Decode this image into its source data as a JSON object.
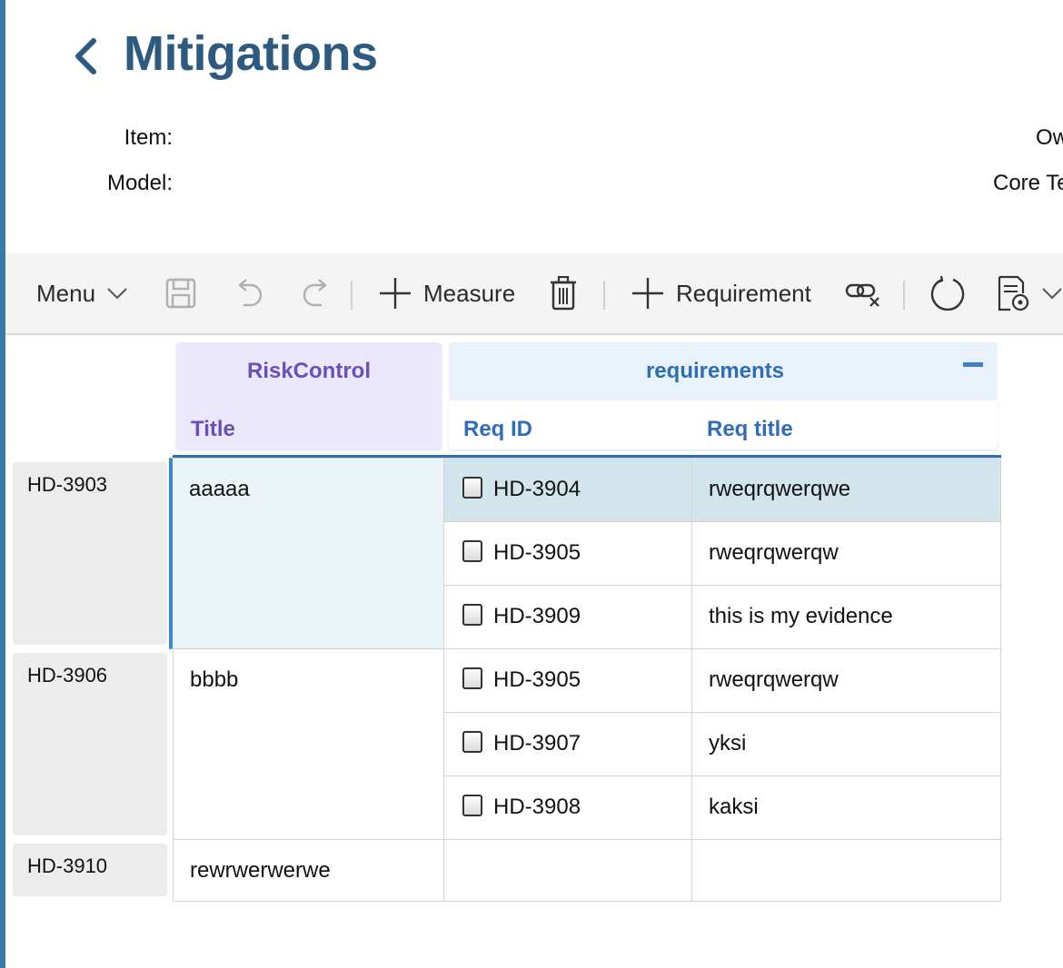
{
  "page": {
    "title": "Mitigations"
  },
  "meta": {
    "item_label": "Item:",
    "model_label": "Model:",
    "owner_partial": "Ow",
    "core_team_partial": "Core Te"
  },
  "toolbar": {
    "menu_label": "Menu",
    "add_measure_label": "Measure",
    "add_requirement_label": "Requirement"
  },
  "grid": {
    "group_riskcontrol": "RiskControl",
    "group_requirements": "requirements",
    "col_title": "Title",
    "col_req_id": "Req ID",
    "col_req_title": "Req title",
    "rows": [
      {
        "id": "HD-3903",
        "title": "aaaaa",
        "requirements": [
          {
            "req_id": "HD-3904",
            "req_title": "rweqrqwerqwe"
          },
          {
            "req_id": "HD-3905",
            "req_title": "rweqrqwerqw"
          },
          {
            "req_id": "HD-3909",
            "req_title": "this is my evidence"
          }
        ]
      },
      {
        "id": "HD-3906",
        "title": "bbbb",
        "requirements": [
          {
            "req_id": "HD-3905",
            "req_title": "rweqrqwerqw"
          },
          {
            "req_id": "HD-3907",
            "req_title": "yksi"
          },
          {
            "req_id": "HD-3908",
            "req_title": "kaksi"
          }
        ]
      },
      {
        "id": "HD-3910",
        "title": "rewrwerwerwe",
        "requirements": []
      }
    ]
  },
  "colors": {
    "title": "#2d5b80",
    "accent": "#3a7aa8",
    "riskcontrol_header_bg": "#ebe8fb",
    "riskcontrol_header_text": "#6a4fb8",
    "requirements_header_bg": "#e9f1fb",
    "requirements_header_text": "#2f6db6",
    "selected_row_bg": "#d3e5ec"
  },
  "icons": [
    "chevron-left-icon",
    "chevron-down-icon",
    "save-icon",
    "undo-icon",
    "redo-icon",
    "plus-icon",
    "trash-icon",
    "unlink-icon",
    "refresh-icon",
    "report-icon"
  ]
}
